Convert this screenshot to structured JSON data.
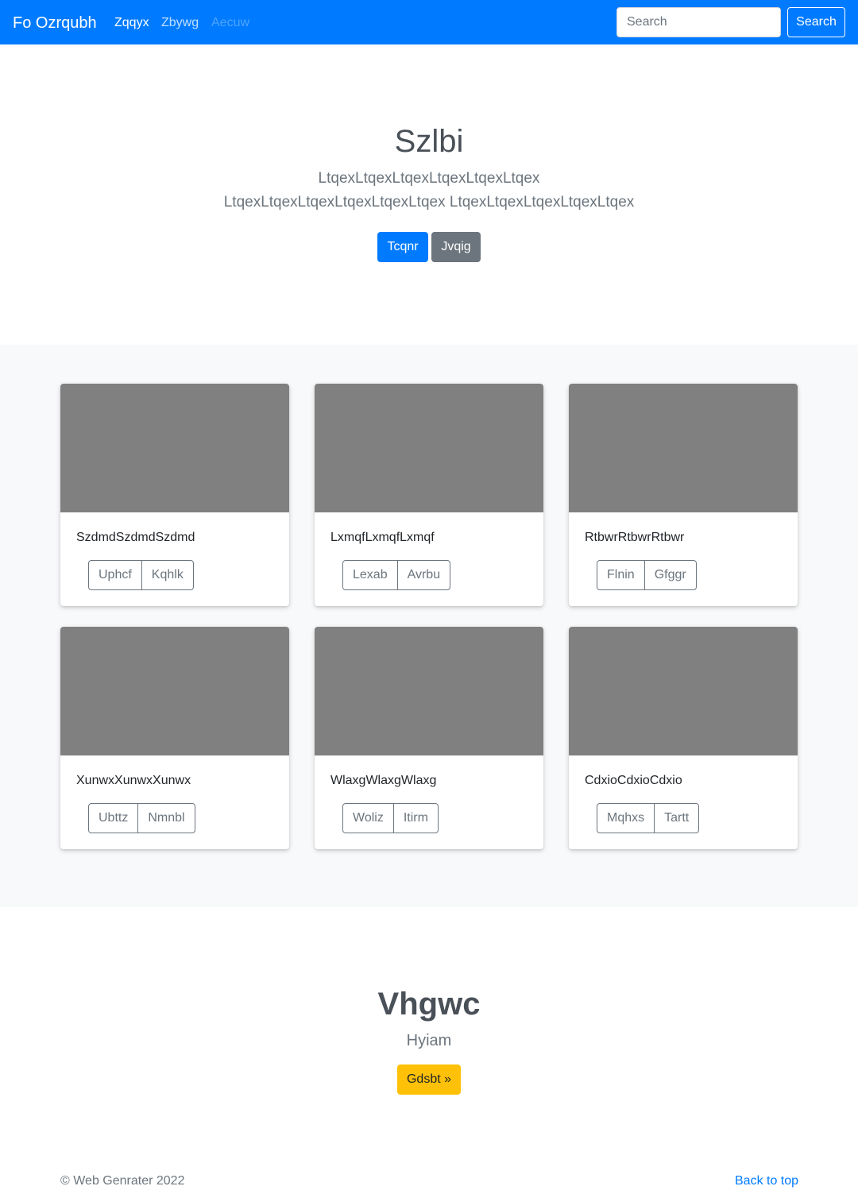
{
  "navbar": {
    "brand": "Fo Ozrqubh",
    "links": [
      {
        "label": "Zqqyx",
        "state": "active"
      },
      {
        "label": "Zbywg",
        "state": "normal"
      },
      {
        "label": "Aecuw",
        "state": "disabled"
      }
    ],
    "search_placeholder": "Search",
    "search_button": "Search"
  },
  "hero": {
    "title": "Szlbi",
    "lead": "LtqexLtqexLtqexLtqexLtqexLtqex LtqexLtqexLtqexLtqexLtqexLtqex LtqexLtqexLtqexLtqexLtqex",
    "primary_button": "Tcqnr",
    "secondary_button": "Jvqig"
  },
  "cards": [
    {
      "text": "SzdmdSzdmdSzdmd",
      "btn1": "Uphcf",
      "btn2": "Kqhlk"
    },
    {
      "text": "LxmqfLxmqfLxmqf",
      "btn1": "Lexab",
      "btn2": "Avrbu"
    },
    {
      "text": "RtbwrRtbwrRtbwr",
      "btn1": "Flnin",
      "btn2": "Gfggr"
    },
    {
      "text": "XunwxXunwxXunwx",
      "btn1": "Ubttz",
      "btn2": "Nmnbl"
    },
    {
      "text": "WlaxgWlaxgWlaxg",
      "btn1": "Woliz",
      "btn2": "Itirm"
    },
    {
      "text": "CdxioCdxioCdxio",
      "btn1": "Mqhxs",
      "btn2": "Tartt"
    }
  ],
  "cta": {
    "title": "Vhgwc",
    "subtitle": "Hyiam",
    "button": "Gdsbt »"
  },
  "footer": {
    "copyright": "© Web Genrater 2022",
    "back_to_top": "Back to top"
  },
  "colors": {
    "primary": "#007bff",
    "secondary": "#6c757d",
    "warning": "#ffc107",
    "placeholder_image": "#808080",
    "album_bg": "#f8f9fa"
  }
}
